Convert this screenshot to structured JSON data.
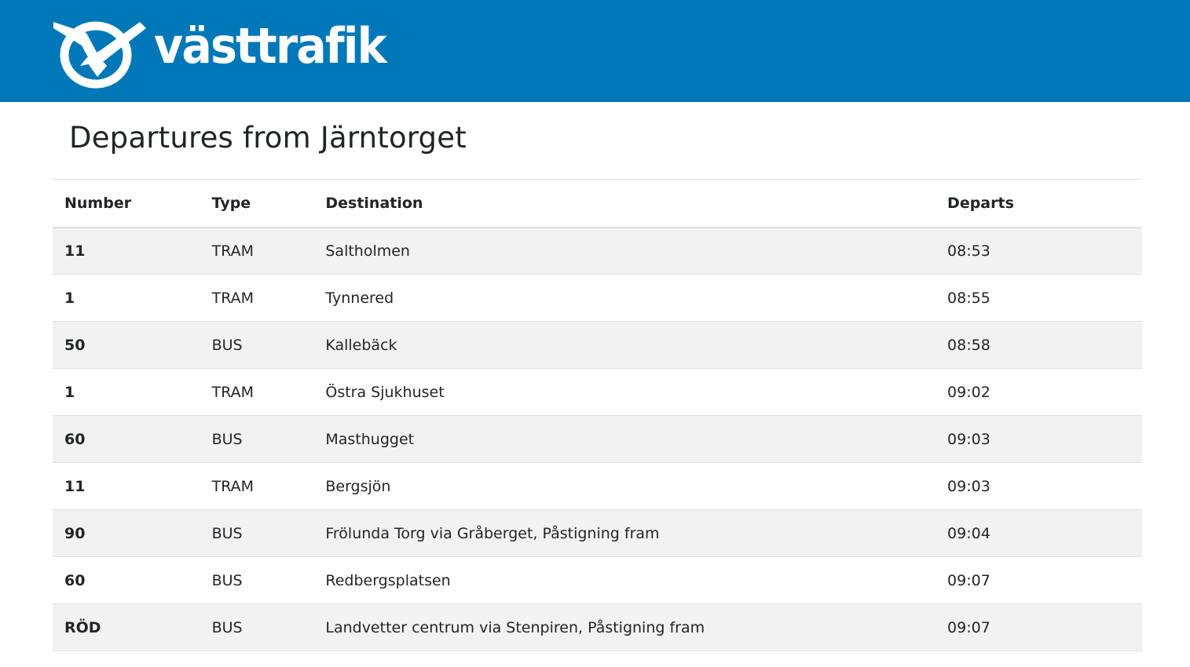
{
  "header": {
    "logo_text": "västtrafik",
    "color": "#0078b8"
  },
  "page_title": "Departures from Järntorget",
  "table": {
    "columns": [
      "Number",
      "Type",
      "Destination",
      "Departs"
    ],
    "rows": [
      {
        "number": "11",
        "type": "TRAM",
        "destination": "Saltholmen",
        "departs": "08:53"
      },
      {
        "number": "1",
        "type": "TRAM",
        "destination": "Tynnered",
        "departs": "08:55"
      },
      {
        "number": "50",
        "type": "BUS",
        "destination": "Kallebäck",
        "departs": "08:58"
      },
      {
        "number": "1",
        "type": "TRAM",
        "destination": "Östra Sjukhuset",
        "departs": "09:02"
      },
      {
        "number": "60",
        "type": "BUS",
        "destination": "Masthugget",
        "departs": "09:03"
      },
      {
        "number": "11",
        "type": "TRAM",
        "destination": "Bergsjön",
        "departs": "09:03"
      },
      {
        "number": "90",
        "type": "BUS",
        "destination": "Frölunda Torg via Gråberget, Påstigning fram",
        "departs": "09:04"
      },
      {
        "number": "60",
        "type": "BUS",
        "destination": "Redbergsplatsen",
        "departs": "09:07"
      },
      {
        "number": "RÖD",
        "type": "BUS",
        "destination": "Landvetter centrum via Stenpiren, Påstigning fram",
        "departs": "09:07"
      }
    ]
  }
}
